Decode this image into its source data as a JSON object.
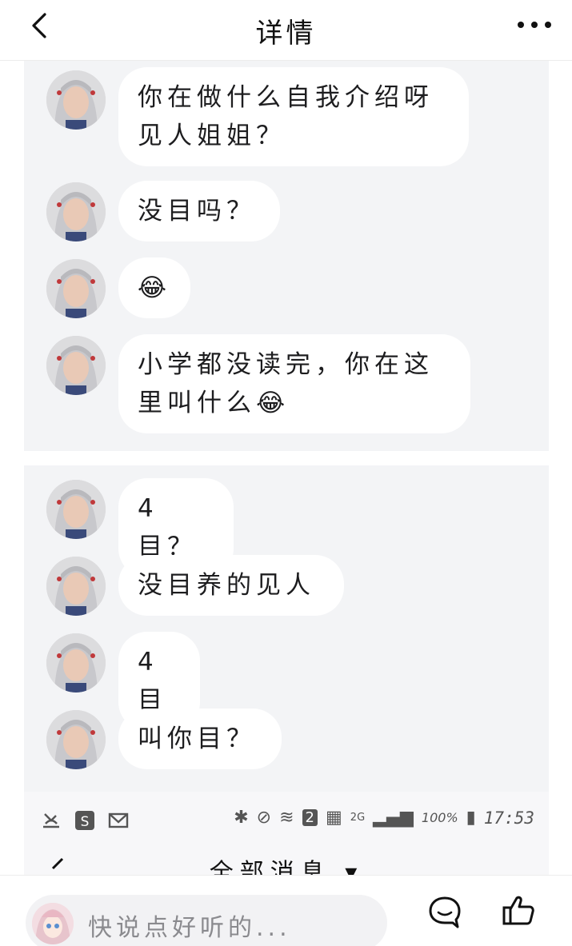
{
  "header": {
    "title": "详情",
    "back_icon": "chevron-left-icon",
    "more_icon": "more-horizontal-icon"
  },
  "screenshot_1": {
    "messages": [
      {
        "text": "你在做什么自我介绍呀\n见人姐姐？"
      },
      {
        "text": "没目吗？"
      },
      {
        "text": "😂"
      },
      {
        "text": "小学都没读完，你在这\n里叫什么😂"
      }
    ]
  },
  "screenshot_2": {
    "messages": [
      {
        "text": "4目？"
      },
      {
        "text": "没目养的见人"
      },
      {
        "text": "4目"
      },
      {
        "text": "叫你目？"
      }
    ]
  },
  "screenshot_3": {
    "status_bar": {
      "battery": "100%",
      "time": "17:53",
      "sim": "2",
      "network": "2G"
    },
    "title": "全部消息 ▾"
  },
  "bottom_bar": {
    "input_placeholder": "快说点好听的...",
    "comment_icon": "comment-icon",
    "like_icon": "thumbs-up-icon"
  },
  "colors": {
    "panel_bg": "#f3f4f6",
    "bubble_bg": "#ffffff",
    "text": "#1d1d1f",
    "placeholder": "#8a8a8e"
  }
}
